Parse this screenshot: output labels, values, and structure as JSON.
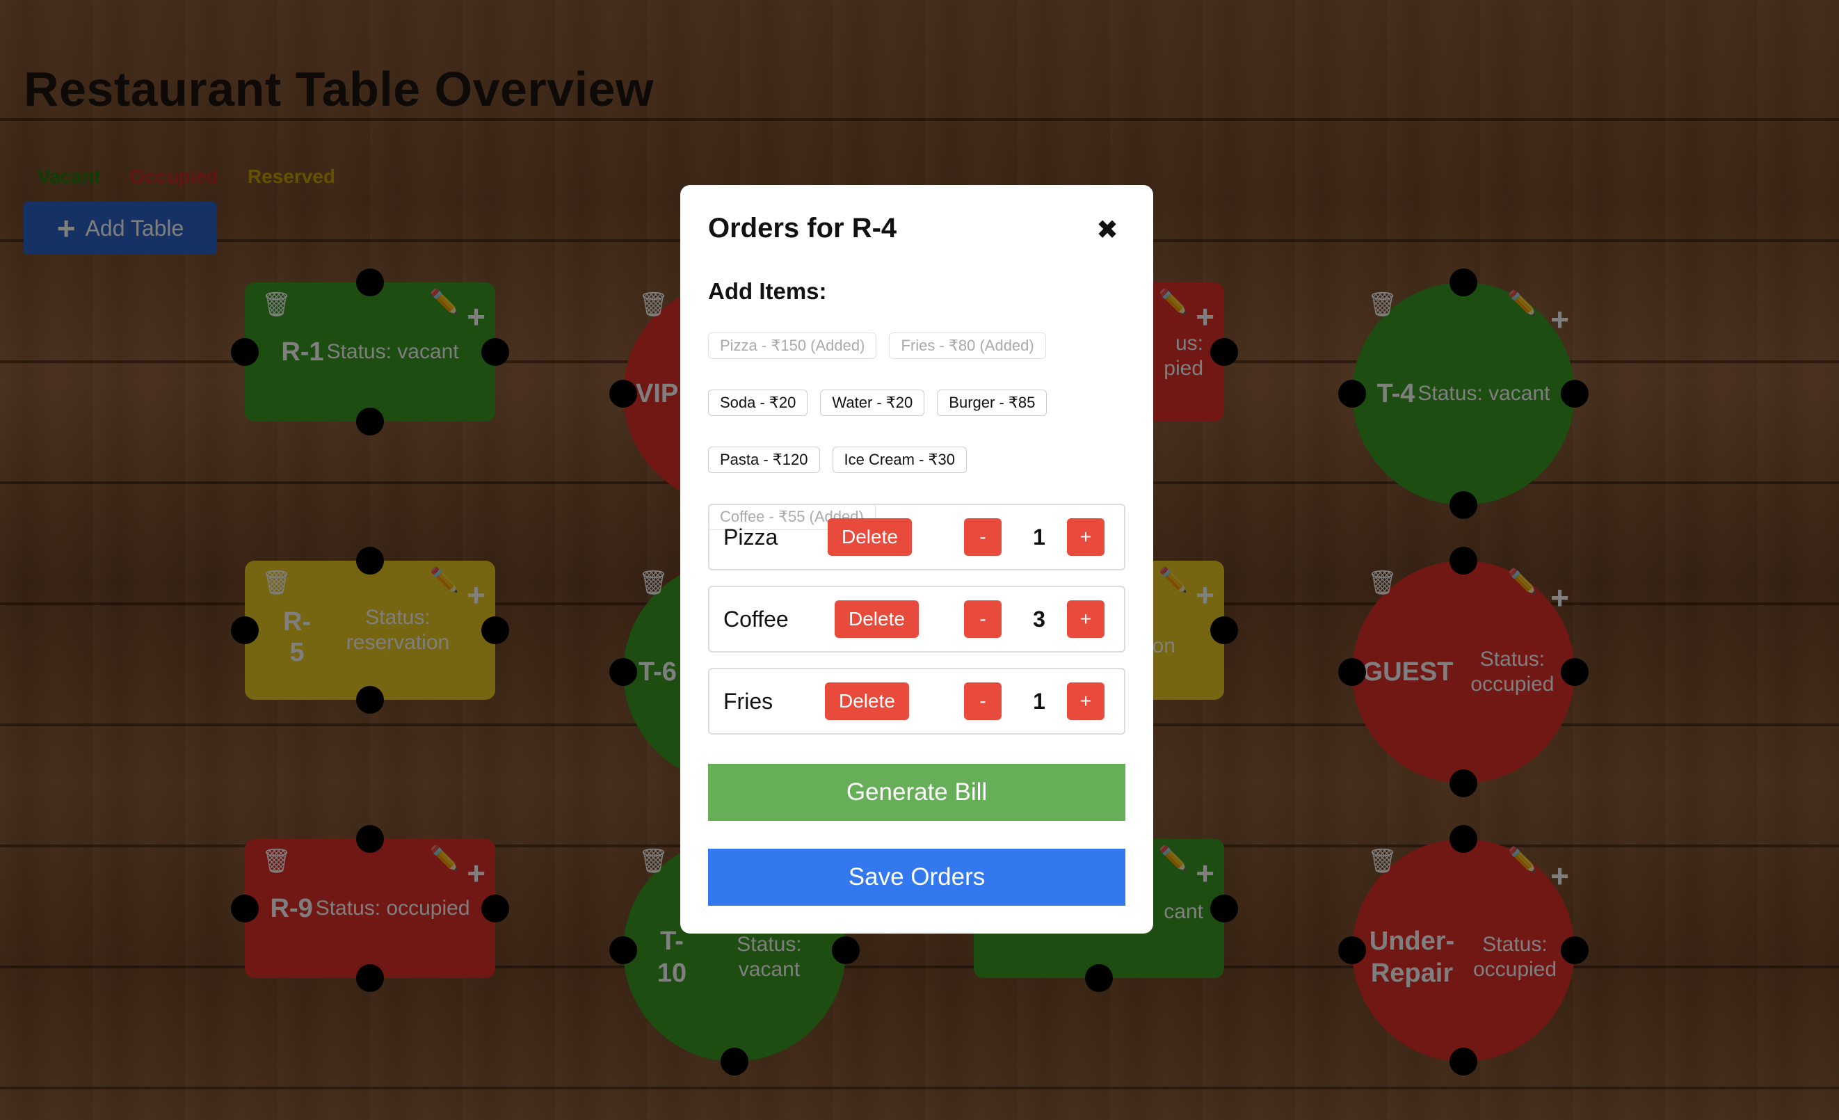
{
  "page": {
    "title": "Restaurant Table Overview"
  },
  "legend": {
    "vacant": "Vacant",
    "occupied": "Occupied",
    "reserved": "Reserved",
    "colors": {
      "vacant": "#1e7a0a",
      "occupied": "#c62828",
      "reserved": "#c9a400"
    }
  },
  "toolbar": {
    "add_table_label": "Add Table",
    "add_icon": "plus-icon"
  },
  "tables": {
    "r1": {
      "id": "R-1",
      "status": "Status: vacant"
    },
    "vip": {
      "id": "VIP"
    },
    "t3": {
      "status_partial_1": "us:",
      "status_partial_2": "pied"
    },
    "t4": {
      "id": "T-4",
      "status": "Status: vacant"
    },
    "r5": {
      "id": "R-5",
      "status": "Status: reservation"
    },
    "t6": {
      "id": "T-6"
    },
    "r7": {
      "status_partial": "on"
    },
    "guest": {
      "id": "GUEST",
      "status": "Status: occupied"
    },
    "r9": {
      "id": "R-9",
      "status": "Status: occupied"
    },
    "t10": {
      "id": "T-10",
      "status": "Status: vacant"
    },
    "r11": {
      "status_partial": "cant"
    },
    "repair": {
      "id": "Under-Repair",
      "status": "Status: occupied"
    },
    "icons": {
      "delete": "trash-icon",
      "edit": "pencil-icon",
      "add": "plus-icon"
    }
  },
  "modal": {
    "title": "Orders for R-4",
    "close": "✖",
    "add_items_label": "Add Items:",
    "menu_items": [
      {
        "label": "Pizza - ₹150 (Added)",
        "added": true
      },
      {
        "label": "Fries - ₹80 (Added)",
        "added": true
      },
      {
        "label": "Soda - ₹20",
        "added": false
      },
      {
        "label": "Water - ₹20",
        "added": false
      },
      {
        "label": "Burger - ₹85",
        "added": false
      },
      {
        "label": "Pasta - ₹120",
        "added": false
      },
      {
        "label": "Ice Cream - ₹30",
        "added": false
      },
      {
        "label": "Coffee - ₹55 (Added)",
        "added": true
      }
    ],
    "orders": [
      {
        "name": "Pizza",
        "delete_label": "Delete",
        "dec": "-",
        "qty": "1",
        "inc": "+"
      },
      {
        "name": "Coffee",
        "delete_label": "Delete",
        "dec": "-",
        "qty": "3",
        "inc": "+"
      },
      {
        "name": "Fries",
        "delete_label": "Delete",
        "dec": "-",
        "qty": "1",
        "inc": "+"
      }
    ],
    "generate_bill_label": "Generate Bill",
    "save_orders_label": "Save Orders"
  },
  "colors": {
    "vacant_table": "#3a9a22",
    "occupied_table": "#e3302a",
    "reserved_table": "#ecca22",
    "add_button": "#2d63c8",
    "delete_button": "#e84a3c",
    "generate_bill": "#67ae58",
    "save_orders": "#3478f0"
  }
}
